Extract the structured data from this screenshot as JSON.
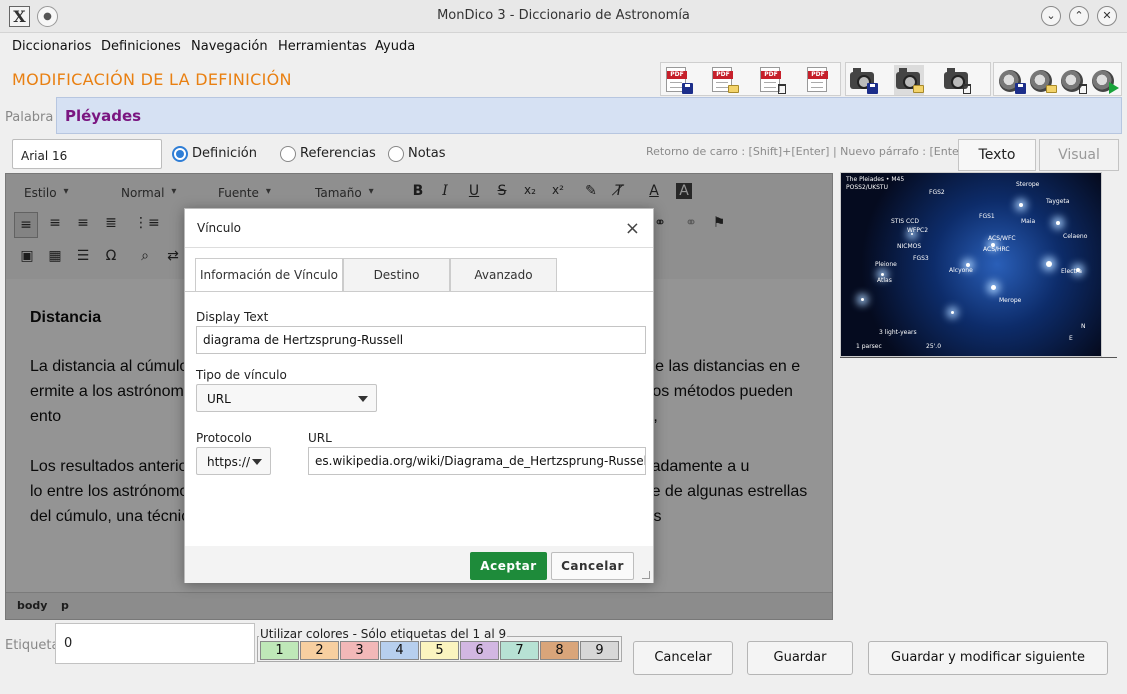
{
  "window": {
    "title": "MonDico 3 - Diccionario de Astronomía",
    "app_icon": "X"
  },
  "menu": [
    "Diccionarios",
    "Definiciones",
    "Navegación",
    "Herramientas",
    "Ayuda"
  ],
  "header": {
    "title": "MODIFICACIÓN DE LA DEFINICIÓN"
  },
  "toolbar": {
    "pdf_label": "PDF",
    "icons": [
      "pdf-save-icon",
      "pdf-open-icon",
      "pdf-delete-icon",
      "pdf-icon",
      "camera-save-icon",
      "camera-open-icon",
      "camera-delete-icon",
      "speaker-save-icon",
      "speaker-open-icon",
      "speaker-delete-icon",
      "speaker-play-icon"
    ]
  },
  "palabra": {
    "label": "Palabra",
    "value": "Pléyades"
  },
  "options": {
    "font": "Arial 16",
    "radios": [
      {
        "label": "Definición",
        "selected": true
      },
      {
        "label": "Referencias",
        "selected": false
      },
      {
        "label": "Notas",
        "selected": false
      }
    ],
    "hint": "Retorno de carro : [Shift]+[Enter] | Nuevo párrafo : [Enter]",
    "view_tabs": [
      "Texto",
      "Visual"
    ]
  },
  "editor_toolbar": {
    "selects": [
      "Estilo",
      "Normal",
      "Fuente",
      "Tamaño"
    ],
    "bold": "B",
    "italic": "I",
    "underline": "U",
    "strike": "S",
    "subscript": "x₂",
    "superscript": "x²",
    "color_text": "A",
    "bg_color": "A",
    "omega": "Ω"
  },
  "content": {
    "heading": "Distancia",
    "paragraph1": "La distancia al cúmulo                                                                        te en la calibración de las distancias en e                                                                   ermite a los astrónomos trazar un                                                                  cúmulos. Otros métodos pueden ento                                                                 as y posteriormente a cúmulos de galaxias,",
    "paragraph2": "Los resultados anterio                                                                     ades estaban aproximadamente a u                                                                    lo entre los astrónomos al encontr                                                                  do la paralaje de algunas estrellas del cúmulo, una técnica que debe indicar los resultados más directos y exactos. Trabajos"
  },
  "status_path": [
    "body",
    "p"
  ],
  "dialog": {
    "title": "Vínculo",
    "close": "×",
    "tabs": [
      "Información de Vínculo",
      "Destino",
      "Avanzado"
    ],
    "display_text_label": "Display Text",
    "display_text_value": "diagrama de Hertzsprung-Russell",
    "tipo_label": "Tipo de vínculo",
    "tipo_value": "URL",
    "protocolo_label": "Protocolo",
    "protocolo_value": "https://",
    "url_label": "URL",
    "url_value": "es.wikipedia.org/wiki/Diagrama_de_Hertzsprung-Russell",
    "ok": "Aceptar",
    "cancel": "Cancelar"
  },
  "image": {
    "caption_title": "The Pleiades • M45",
    "caption_source": "POSS2/UKSTU",
    "labels": [
      "Sterope",
      "Taygeta",
      "Maia",
      "Celaeno",
      "Electra",
      "Alcyone",
      "Merope",
      "Pleione",
      "Atlas",
      "FGS1",
      "FGS2",
      "FGS3",
      "STIS CCD",
      "WFPC2",
      "NICMOS",
      "ACS/WFC",
      "ACS/HRC"
    ],
    "scale_1": "3 light-years",
    "scale_2": "1 parsec",
    "scale_3": "25'.0",
    "north": "N",
    "east": "E"
  },
  "bottom": {
    "etiqueta_label": "Etiqueta",
    "etiqueta_value": "0",
    "colors_title": "Utilizar colores - Sólo etiquetas del 1 al 9",
    "colors": [
      {
        "n": "1",
        "color": "#bfe8b8"
      },
      {
        "n": "2",
        "color": "#f7cfa0"
      },
      {
        "n": "3",
        "color": "#f2b8b8"
      },
      {
        "n": "4",
        "color": "#b7cfee"
      },
      {
        "n": "5",
        "color": "#fbf4bf"
      },
      {
        "n": "6",
        "color": "#d2b7e2"
      },
      {
        "n": "7",
        "color": "#b7e2d4"
      },
      {
        "n": "8",
        "color": "#d9a57a"
      },
      {
        "n": "9",
        "color": "#d7d7d7"
      }
    ],
    "cancel": "Cancelar",
    "save": "Guardar",
    "save_next": "Guardar y modificar siguiente"
  }
}
